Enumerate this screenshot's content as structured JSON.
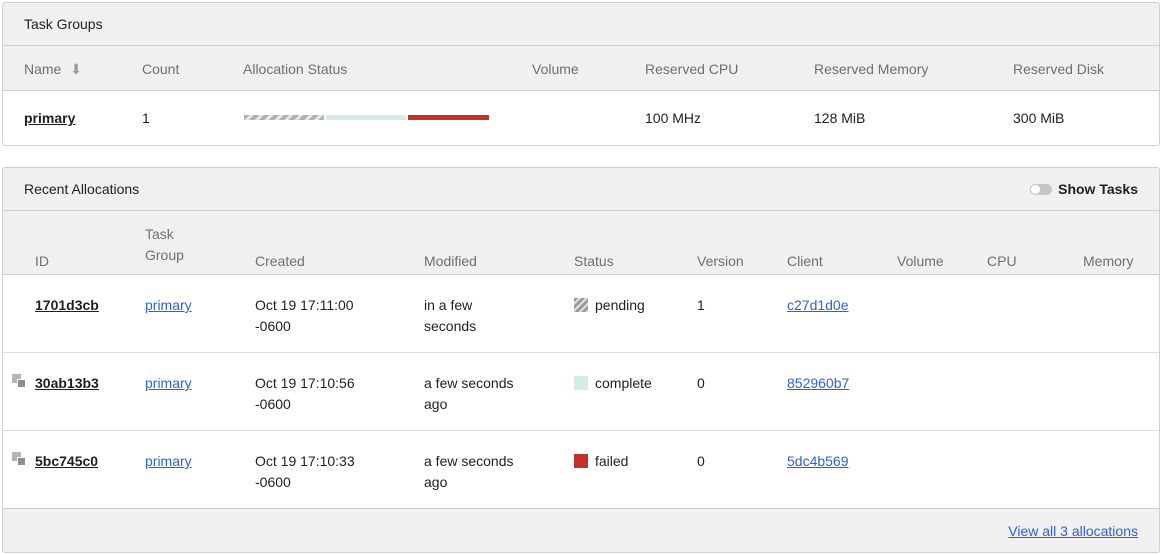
{
  "task_groups": {
    "title": "Task Groups",
    "columns": {
      "name": "Name",
      "count": "Count",
      "allocation_status": "Allocation Status",
      "volume": "Volume",
      "reserved_cpu": "Reserved CPU",
      "reserved_memory": "Reserved Memory",
      "reserved_disk": "Reserved Disk"
    },
    "sort_icon": "arrow-down-icon",
    "rows": [
      {
        "name": "primary",
        "count": "1",
        "allocation_status": {
          "pending": 1,
          "complete": 1,
          "failed": 1
        },
        "volume": "",
        "reserved_cpu": "100 MHz",
        "reserved_memory": "128 MiB",
        "reserved_disk": "300 MiB"
      }
    ]
  },
  "recent_allocations": {
    "title": "Recent Allocations",
    "toggle_label": "Show Tasks",
    "toggle_on": false,
    "columns": {
      "id": "ID",
      "task_group_1": "Task",
      "task_group_2": "Group",
      "created": "Created",
      "modified": "Modified",
      "status": "Status",
      "version": "Version",
      "client": "Client",
      "volume": "Volume",
      "cpu": "CPU",
      "memory": "Memory"
    },
    "rows": [
      {
        "id": "1701d3cb",
        "rescheduled": false,
        "task_group": "primary",
        "created_1": "Oct 19 17:11:00",
        "created_2": "-0600",
        "modified_1": "in a few",
        "modified_2": "seconds",
        "status": "pending",
        "version": "1",
        "client": "c27d1d0e"
      },
      {
        "id": "30ab13b3",
        "rescheduled": true,
        "task_group": "primary",
        "created_1": "Oct 19 17:10:56",
        "created_2": "-0600",
        "modified_1": "a few seconds",
        "modified_2": "ago",
        "status": "complete",
        "version": "0",
        "client": "852960b7"
      },
      {
        "id": "5bc745c0",
        "rescheduled": true,
        "task_group": "primary",
        "created_1": "Oct 19 17:10:33",
        "created_2": "-0600",
        "modified_1": "a few seconds",
        "modified_2": "ago",
        "status": "failed",
        "version": "0",
        "client": "5dc4b569"
      }
    ],
    "footer_link": "View all 3 allocations"
  },
  "colors": {
    "pending": "#b0b0b0",
    "complete": "#d4ece6",
    "failed": "#c4302b",
    "link": "#2e5fe0",
    "header_bg": "#f0f0f0"
  }
}
